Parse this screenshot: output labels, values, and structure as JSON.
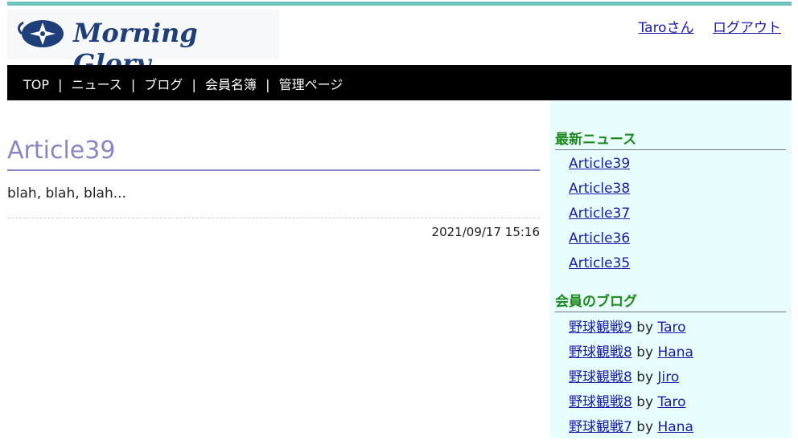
{
  "brand": {
    "logo_text": "Morning Glory"
  },
  "user_links": {
    "user": "Taroさん",
    "logout": "ログアウト"
  },
  "nav": {
    "items": [
      "TOP",
      "ニュース",
      "ブログ",
      "会員名簿",
      "管理ページ"
    ],
    "separator": "|"
  },
  "article": {
    "title": "Article39",
    "body": "blah, blah, blah...",
    "timestamp": "2021/09/17 15:16"
  },
  "sidebar": {
    "news_heading": "最新ニュース",
    "news": [
      "Article39",
      "Article38",
      "Article37",
      "Article36",
      "Article35"
    ],
    "blog_heading": "会員のブログ",
    "blogs": [
      {
        "title": "野球観戦9",
        "by": "by",
        "author": "Taro"
      },
      {
        "title": "野球観戦8",
        "by": "by",
        "author": "Hana"
      },
      {
        "title": "野球観戦8",
        "by": "by",
        "author": "Jiro"
      },
      {
        "title": "野球観戦8",
        "by": "by",
        "author": "Taro"
      },
      {
        "title": "野球観戦7",
        "by": "by",
        "author": "Hana"
      }
    ]
  },
  "colors": {
    "accent_bar": "#6cc4bd",
    "nav_bg": "#000000",
    "title": "#8a85c4",
    "sidebar_bg": "#e8fefe",
    "sidebar_heading": "#1e8a1e",
    "link": "#1a1aa6"
  },
  "icons": {
    "logo": "morning-glory-flower-icon"
  }
}
